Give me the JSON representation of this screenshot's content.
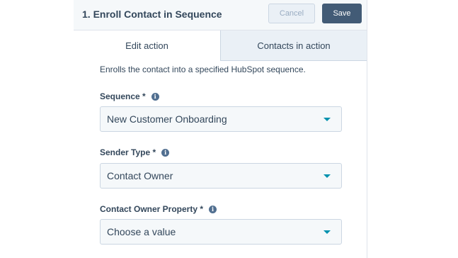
{
  "header": {
    "title": "1. Enroll Contact in Sequence",
    "cancel_label": "Cancel",
    "save_label": "Save"
  },
  "tabs": [
    {
      "label": "Edit action",
      "active": true
    },
    {
      "label": "Contacts in action",
      "active": false
    }
  ],
  "description": "Enrolls the contact into a specified HubSpot sequence.",
  "fields": [
    {
      "label": "Sequence *",
      "value": "New Customer Onboarding",
      "icon": "info-icon"
    },
    {
      "label": "Sender Type *",
      "value": "Contact Owner",
      "icon": "info-icon"
    },
    {
      "label": "Contact Owner Property *",
      "value": "Choose a value",
      "icon": "info-icon"
    }
  ],
  "colors": {
    "header_bg": "#f5f8fa",
    "save_button": "#425b76",
    "caret": "#0091ae",
    "text": "#33475b"
  }
}
